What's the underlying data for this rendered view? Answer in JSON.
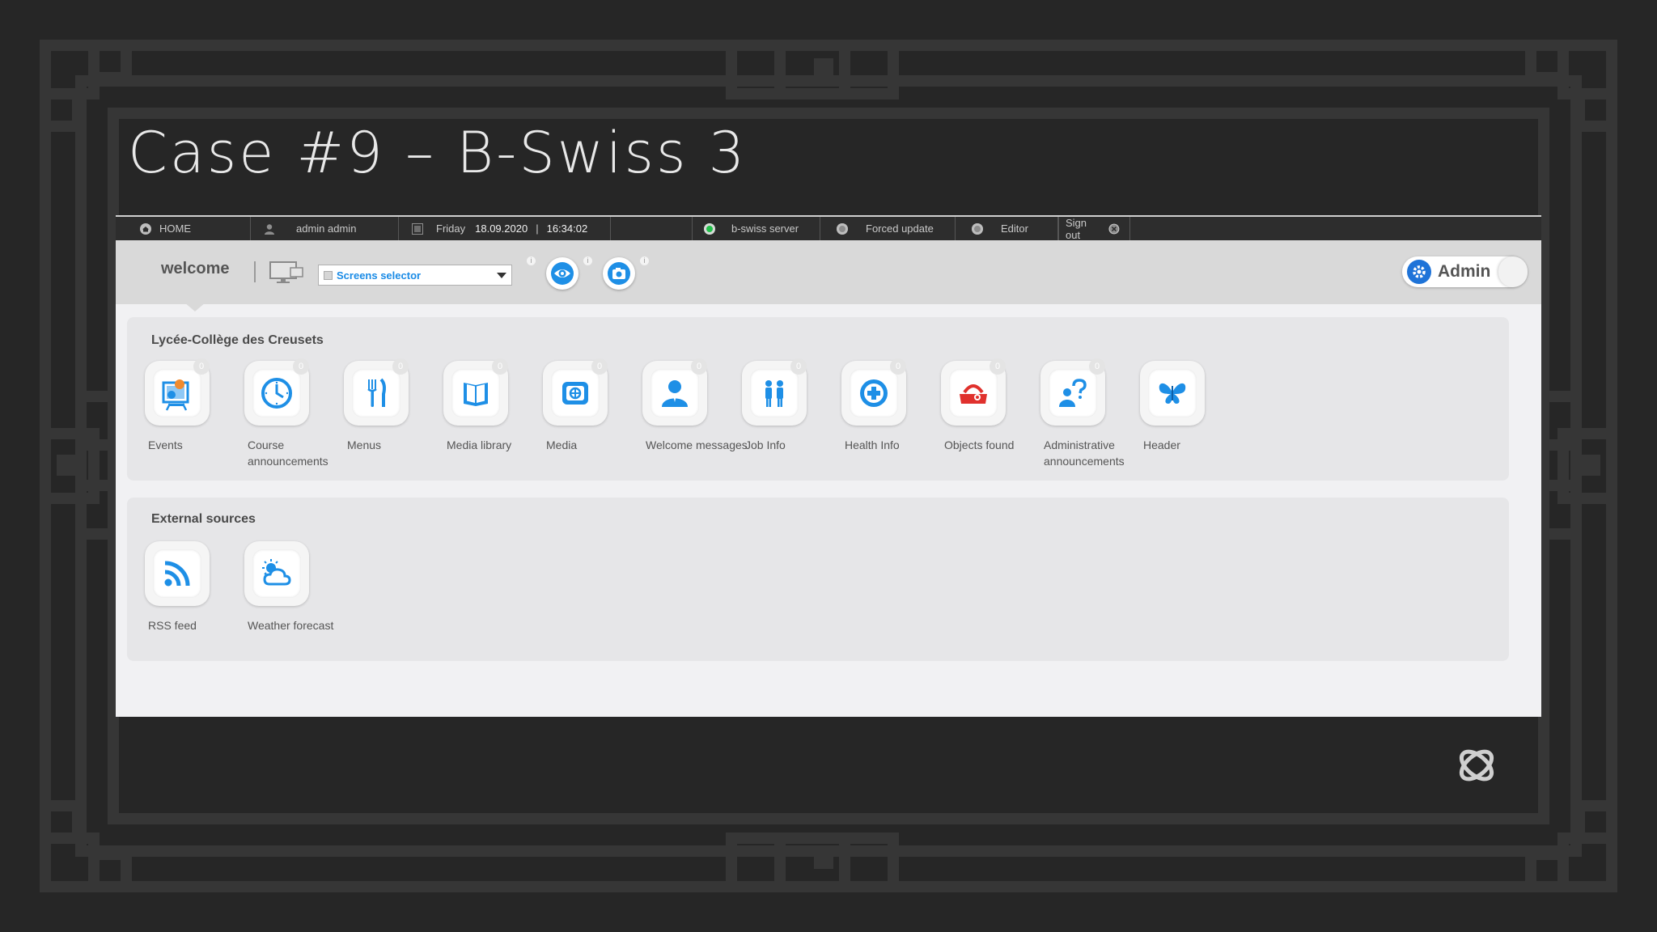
{
  "slide": {
    "title": "Case #9 – B-Swiss 3"
  },
  "topbar": {
    "home": "HOME",
    "user": "admin admin",
    "day": "Friday",
    "date": "18.09.2020",
    "separator": "|",
    "time": "16:34:02",
    "server": "b-swiss server",
    "forced_update": "Forced update",
    "editor": "Editor",
    "sign_out": "Sign out"
  },
  "toolbar": {
    "welcome": "welcome",
    "screens_selector": "Screens selector",
    "admin": "Admin"
  },
  "sections": [
    {
      "title": "Lycée-Collège des Creusets",
      "modules": [
        {
          "label": "Events",
          "badge": "0",
          "icon": "events-icon"
        },
        {
          "label": "Course announcements",
          "badge": "0",
          "icon": "clock-icon"
        },
        {
          "label": "Menus",
          "badge": "0",
          "icon": "fork-knife-icon"
        },
        {
          "label": "Media library",
          "badge": "0",
          "icon": "book-icon"
        },
        {
          "label": "Media",
          "badge": "0",
          "icon": "media-icon"
        },
        {
          "label": "Welcome messages",
          "badge": "0",
          "icon": "person-icon"
        },
        {
          "label": "Job Info",
          "badge": "0",
          "icon": "people-icon"
        },
        {
          "label": "Health Info",
          "badge": "0",
          "icon": "health-plus-icon"
        },
        {
          "label": "Objects found",
          "badge": "0",
          "icon": "lost-bag-icon"
        },
        {
          "label": "Administrative announcements",
          "badge": "0",
          "icon": "question-person-icon"
        },
        {
          "label": "Header",
          "badge": "",
          "icon": "butterfly-icon"
        }
      ]
    },
    {
      "title": "External sources",
      "modules": [
        {
          "label": "RSS feed",
          "badge": "",
          "icon": "rss-icon"
        },
        {
          "label": "Weather forecast",
          "badge": "",
          "icon": "weather-icon"
        }
      ]
    }
  ],
  "colors": {
    "accent": "#1e8fe6",
    "status_green": "#22c24a",
    "objects_red": "#e0312d",
    "background": "#262626"
  }
}
